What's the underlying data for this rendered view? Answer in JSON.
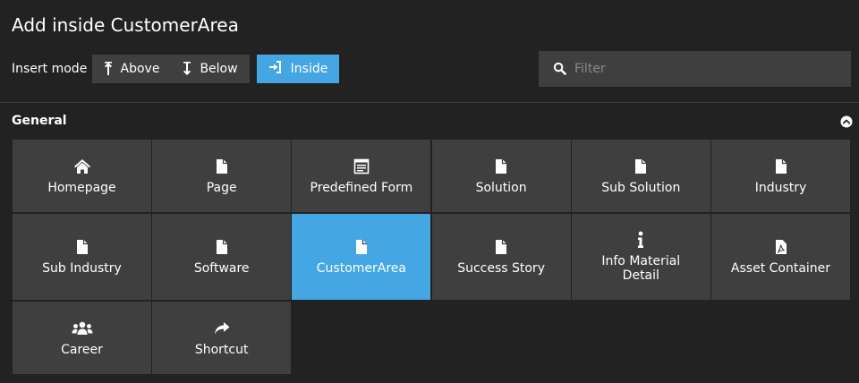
{
  "dialog": {
    "title": "Add inside CustomerArea"
  },
  "insert_mode": {
    "label": "Insert mode",
    "above_label": "Above",
    "below_label": "Below",
    "inside_label": "Inside",
    "selected": "Inside"
  },
  "filter": {
    "placeholder": "Filter",
    "value": ""
  },
  "section": {
    "title": "General"
  },
  "tiles": [
    {
      "label": "Homepage",
      "icon": "home-icon"
    },
    {
      "label": "Page",
      "icon": "file-icon"
    },
    {
      "label": "Predefined Form",
      "icon": "form-icon"
    },
    {
      "label": "Solution",
      "icon": "file-icon"
    },
    {
      "label": "Sub Solution",
      "icon": "file-icon"
    },
    {
      "label": "Industry",
      "icon": "file-icon"
    },
    {
      "label": "Sub Industry",
      "icon": "file-icon"
    },
    {
      "label": "Software",
      "icon": "file-icon"
    },
    {
      "label": "CustomerArea",
      "icon": "file-icon",
      "active": true
    },
    {
      "label": "Success Story",
      "icon": "file-icon"
    },
    {
      "label": "Info Material Detail",
      "icon": "info-icon"
    },
    {
      "label": "Asset Container",
      "icon": "file-pdf-icon"
    },
    {
      "label": "Career",
      "icon": "users-icon"
    },
    {
      "label": "Shortcut",
      "icon": "share-icon"
    }
  ],
  "colors": {
    "background": "#222222",
    "tile": "#3f3f3f",
    "accent": "#44a7e3",
    "divider": "#3a3a3a"
  }
}
